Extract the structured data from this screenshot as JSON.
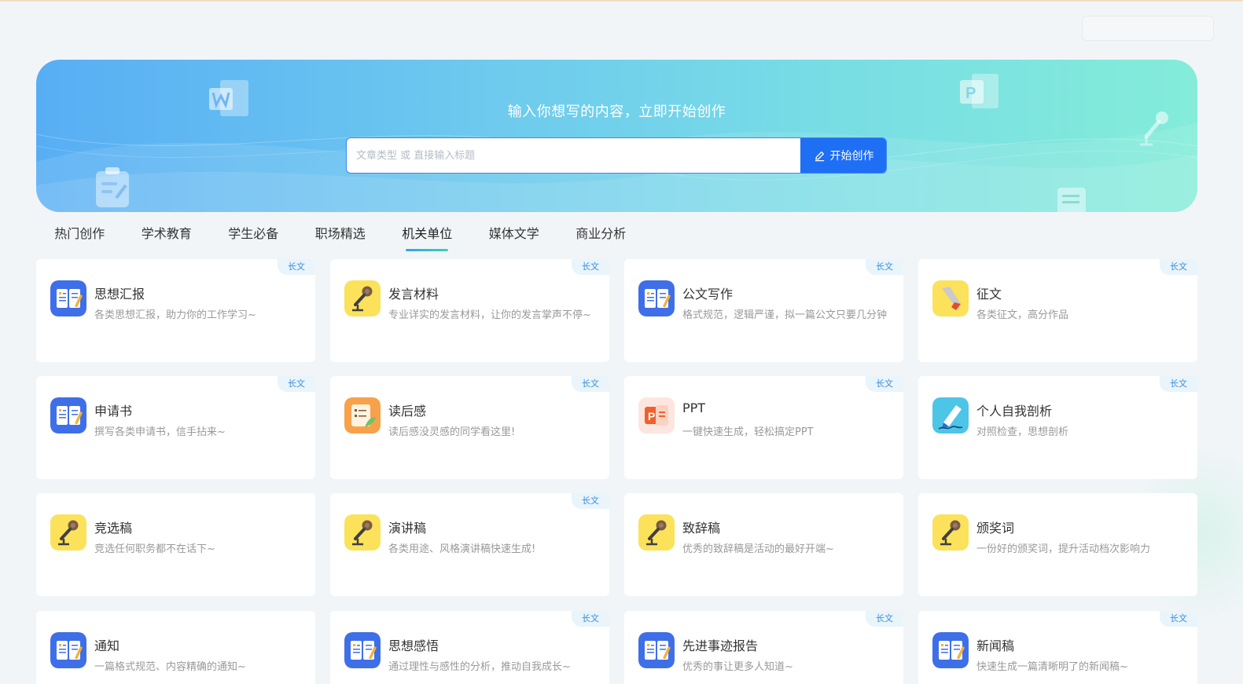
{
  "hero": {
    "title": "输入你想写的内容，立即开始创作",
    "search_placeholder": "文章类型 或 直接输入标题",
    "start_button": "开始创作"
  },
  "tabs": [
    {
      "label": "热门创作"
    },
    {
      "label": "学术教育"
    },
    {
      "label": "学生必备"
    },
    {
      "label": "职场精选"
    },
    {
      "label": "机关单位",
      "active": true
    },
    {
      "label": "媒体文学"
    },
    {
      "label": "商业分析"
    }
  ],
  "badge_label": "长文",
  "cards": [
    {
      "title": "思想汇报",
      "desc": "各类思想汇报，助力你的工作学习~",
      "icon": "book-icon",
      "badge": true
    },
    {
      "title": "发言材料",
      "desc": "专业详实的发言材料，让你的发言掌声不停~",
      "icon": "microphone-icon",
      "badge": true
    },
    {
      "title": "公文写作",
      "desc": "格式规范，逻辑严谨，拟一篇公文只要几分钟",
      "icon": "book-icon",
      "badge": true
    },
    {
      "title": "征文",
      "desc": "各类征文，高分作品",
      "icon": "pen-icon",
      "badge": true
    },
    {
      "title": "申请书",
      "desc": "撰写各类申请书，信手拈来~",
      "icon": "book-icon",
      "badge": true
    },
    {
      "title": "读后感",
      "desc": "读后感没灵感的同学看这里!",
      "icon": "reading-notes-icon",
      "badge": true
    },
    {
      "title": "PPT",
      "desc": "一键快速生成，轻松搞定PPT",
      "icon": "ppt-icon",
      "badge": true
    },
    {
      "title": "个人自我剖析",
      "desc": "对照检查，思想剖析",
      "icon": "signature-pen-icon",
      "badge": true
    },
    {
      "title": "竞选稿",
      "desc": "竞选任何职务都不在话下~",
      "icon": "microphone-icon",
      "badge": false
    },
    {
      "title": "演讲稿",
      "desc": "各类用途、风格演讲稿快速生成!",
      "icon": "microphone-icon",
      "badge": true
    },
    {
      "title": "致辞稿",
      "desc": "优秀的致辞稿是活动的最好开端~",
      "icon": "microphone-icon",
      "badge": false
    },
    {
      "title": "颁奖词",
      "desc": "一份好的颁奖词，提升活动档次影响力",
      "icon": "microphone-icon",
      "badge": false
    },
    {
      "title": "通知",
      "desc": "一篇格式规范、内容精确的通知~",
      "icon": "book-icon",
      "badge": false
    },
    {
      "title": "思想感悟",
      "desc": "通过理性与感性的分析，推动自我成长~",
      "icon": "book-icon",
      "badge": true
    },
    {
      "title": "先进事迹报告",
      "desc": "优秀的事让更多人知道~",
      "icon": "book-icon",
      "badge": true
    },
    {
      "title": "新闻稿",
      "desc": "快速生成一篇清晰明了的新闻稿~",
      "icon": "book-icon",
      "badge": true
    }
  ],
  "colors": {
    "accent": "#1f6ff5",
    "hero_start": "#58aef4",
    "hero_end": "#84ecd9",
    "badge_text": "#3c8fd8",
    "page_bg": "#f2f5f8"
  }
}
